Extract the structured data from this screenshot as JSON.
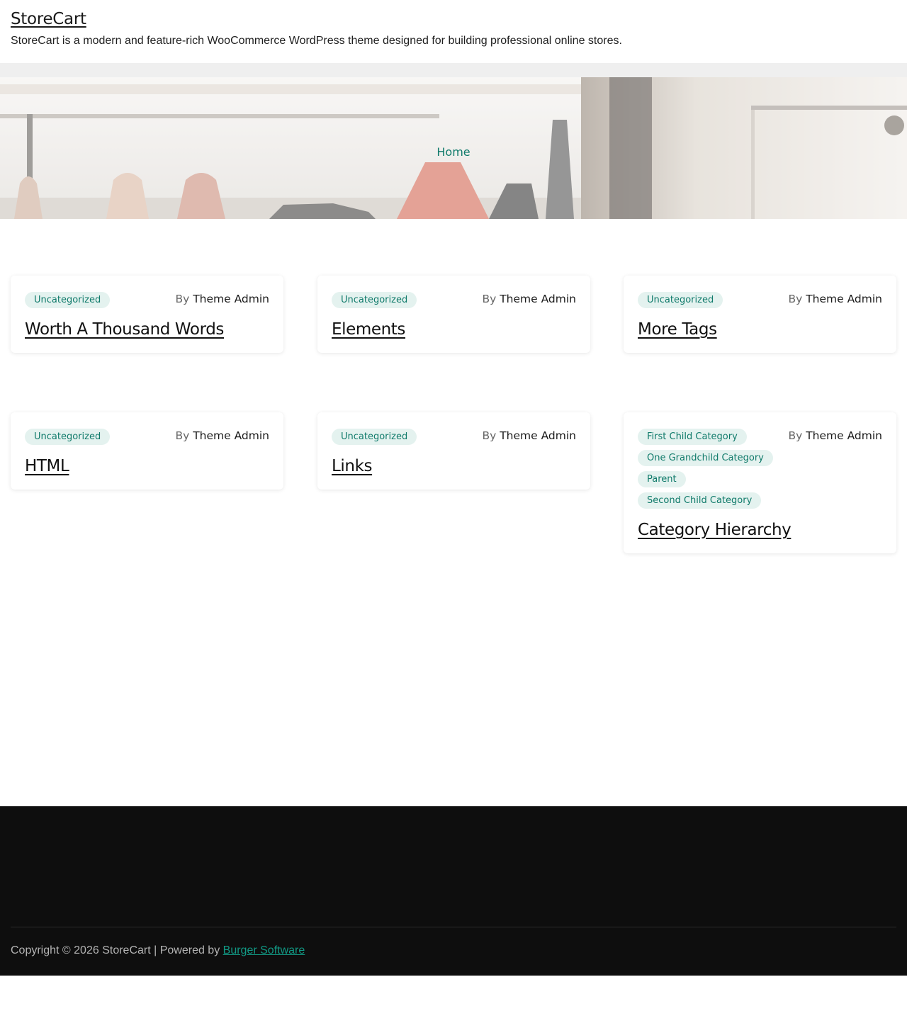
{
  "header": {
    "site_title": "StoreCart",
    "site_description": "StoreCart is a modern and feature-rich WooCommerce WordPress theme designed for building professional online stores."
  },
  "hero": {
    "breadcrumb": "Home"
  },
  "posts": [
    {
      "categories": [
        "Uncategorized"
      ],
      "by_label": "By",
      "author": "Theme Admin",
      "title": "Worth A Thousand Words"
    },
    {
      "categories": [
        "Uncategorized"
      ],
      "by_label": "By",
      "author": "Theme Admin",
      "title": "Elements"
    },
    {
      "categories": [
        "Uncategorized"
      ],
      "by_label": "By",
      "author": "Theme Admin",
      "title": "More Tags"
    },
    {
      "categories": [
        "Uncategorized"
      ],
      "by_label": "By",
      "author": "Theme Admin",
      "title": "HTML"
    },
    {
      "categories": [
        "Uncategorized"
      ],
      "by_label": "By",
      "author": "Theme Admin",
      "title": "Links"
    },
    {
      "categories": [
        "First Child Category",
        "One Grandchild Category",
        "Parent",
        "Second Child Category"
      ],
      "by_label": "By",
      "author": "Theme Admin",
      "title": "Category Hierarchy"
    }
  ],
  "footer": {
    "copyright": "Copyright © 2026 StoreCart | Powered by ",
    "link_text": "Burger Software"
  },
  "colors": {
    "accent": "#0f7a6a",
    "tag_bg": "#e4f2ef",
    "footer_bg": "#0e0e0e"
  }
}
